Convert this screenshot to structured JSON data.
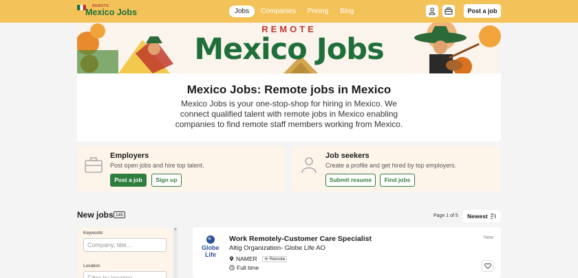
{
  "nav": {
    "logo_small": "REMOTE",
    "logo_main": "Mexico Jobs",
    "links": [
      {
        "label": "Jobs",
        "active": true
      },
      {
        "label": "Companies",
        "active": false
      },
      {
        "label": "Pricing",
        "active": false
      },
      {
        "label": "Blog",
        "active": false
      }
    ],
    "icons": [
      "user-icon",
      "briefcase-icon"
    ],
    "post_job": "Post a job"
  },
  "hero": {
    "banner_remote": "REMOTE",
    "banner_title": "Mexico Jobs",
    "title": "Mexico Jobs: Remote jobs in Mexico",
    "description": "Mexico Jobs is your one-stop-shop for hiring in Mexico. We connect qualified talent with remote jobs in Mexico enabling companies to find remote staff members working from Mexico."
  },
  "employers": {
    "title": "Employers",
    "subtitle": "Post open jobs and hire top talent.",
    "primary": "Post a job",
    "secondary": "Sign up"
  },
  "seekers": {
    "title": "Job seekers",
    "subtitle": "Create a profile and get hired by top employers.",
    "primary": "Submit resume",
    "secondary": "Find jobs"
  },
  "jobs_header": {
    "title": "New jobs",
    "count": "145",
    "page_info": "Page 1 of 5",
    "sort": "Newest"
  },
  "filters": {
    "keywords_label": "Keywords",
    "keywords_placeholder": "Company, title...",
    "location_label": "Location",
    "location_placeholder": "Filter by location..."
  },
  "job": {
    "logo_text_1": "Globe",
    "logo_text_2": "Life",
    "title": "Work Remotely-Customer Care Specialist",
    "company": "Altig Organization- Globe Life AO",
    "location": "NAMER",
    "tag": "Remote",
    "type": "Full time",
    "badge": "New"
  },
  "colors": {
    "nav_bg": "#f3c35a",
    "brand_green": "#2f7d3f",
    "card_bg": "#fdf4ea"
  }
}
